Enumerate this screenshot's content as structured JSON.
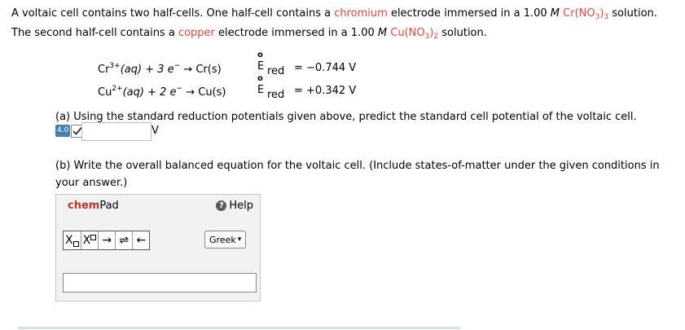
{
  "intro": {
    "l1_a": "A voltaic cell contains two half-cells. One half-cell contains a ",
    "l1_metal": "chromium",
    "l1_b": " electrode immersed in a 1.00 ",
    "l1_M": "M",
    "l1_c": " Cr(NO",
    "l1_sub1": "3",
    "l1_d": ")",
    "l1_sub2": "3",
    "l1_e": " solution.",
    "l2_a": "The second half-cell contains a ",
    "l2_metal": "copper",
    "l2_b": " electrode immersed in a 1.00 ",
    "l2_M": "M",
    "l2_c": " Cu(NO",
    "l2_sub1": "3",
    "l2_d": ")",
    "l2_sub2": "2",
    "l2_e": " solution."
  },
  "reactions": [
    {
      "ion": "Cr",
      "charge": "3+",
      "rest": "(aq) + 3 e",
      "minus": "−",
      "arrow": " → Cr(s)",
      "e_label": "E",
      "deg": "o",
      "red": "red",
      "value": "= −0.744 V"
    },
    {
      "ion": "Cu",
      "charge": "2+",
      "rest": "(aq) + 2 e",
      "minus": "−",
      "arrow": " → Cu(s)",
      "e_label": "E",
      "deg": "o",
      "red": "red",
      "value": "= +0.342 V"
    }
  ],
  "part_a": {
    "question": "(a) Using the standard reduction potentials given above, predict the standard cell potential of the voltaic cell.",
    "points": "4.0",
    "answer": "",
    "unit": "V"
  },
  "part_b": {
    "question_l1": "(b) Write the overall balanced equation for the voltaic cell. (Include states-of-matter under the given conditions in",
    "question_l2": "your answer.)"
  },
  "chempad": {
    "title_a": "chem",
    "title_b": "Pad",
    "help": "Help",
    "toolbar": {
      "sub": "X",
      "sup": "X",
      "arrow": "→",
      "equilibrium": "⇌",
      "back": "←"
    },
    "greek": "Greek",
    "greek_caret": "▾",
    "input_value": ""
  },
  "colors": {
    "highlight": "#e8453c",
    "chem": "#c0392b",
    "badge": "#4a7fb6"
  }
}
